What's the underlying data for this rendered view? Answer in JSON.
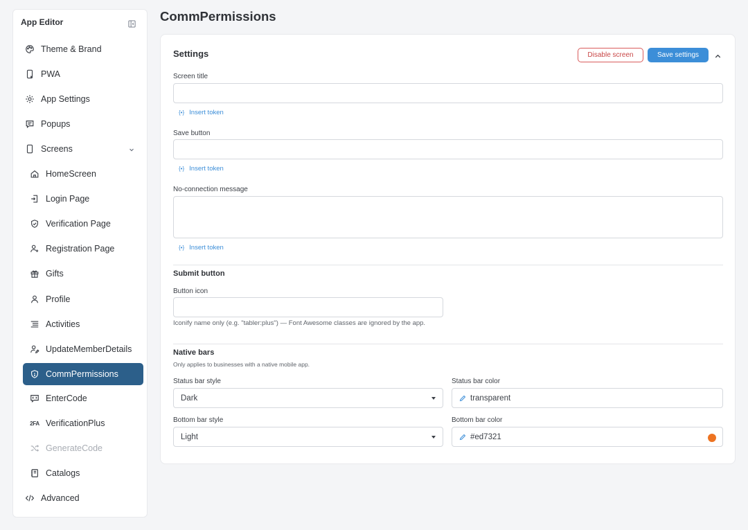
{
  "sidebar": {
    "title": "App Editor",
    "items": [
      {
        "label": "Theme & Brand",
        "icon": "palette-icon"
      },
      {
        "label": "PWA",
        "icon": "phone-icon"
      },
      {
        "label": "App Settings",
        "icon": "gear-icon"
      },
      {
        "label": "Popups",
        "icon": "message-icon"
      },
      {
        "label": "Screens",
        "icon": "phone-icon"
      },
      {
        "label": "HomeScreen",
        "icon": "home-icon"
      },
      {
        "label": "Login Page",
        "icon": "login-icon"
      },
      {
        "label": "Verification Page",
        "icon": "shield-check-icon"
      },
      {
        "label": "Registration Page",
        "icon": "user-plus-icon"
      },
      {
        "label": "Gifts",
        "icon": "gift-icon"
      },
      {
        "label": "Profile",
        "icon": "user-icon"
      },
      {
        "label": "Activities",
        "icon": "list-icon"
      },
      {
        "label": "UpdateMemberDetails",
        "icon": "user-edit-icon"
      },
      {
        "label": "CommPermissions",
        "icon": "shield-icon"
      },
      {
        "label": "EnterCode",
        "icon": "code-chat-icon"
      },
      {
        "label": "VerificationPlus",
        "icon": "2fa-icon",
        "icon_text": "2FA"
      },
      {
        "label": "GenerateCode",
        "icon": "shuffle-icon"
      },
      {
        "label": "Catalogs",
        "icon": "book-icon"
      },
      {
        "label": "Advanced",
        "icon": "code-icon"
      }
    ]
  },
  "page": {
    "title": "CommPermissions"
  },
  "settings": {
    "title": "Settings",
    "disable_label": "Disable screen",
    "save_label": "Save settings",
    "screen_title_label": "Screen title",
    "screen_title_value": "",
    "save_button_label": "Save button",
    "save_button_value": "",
    "no_connection_label": "No-connection message",
    "no_connection_value": "",
    "insert_token": "Insert token",
    "token_icon_text": "{•}",
    "submit_section": "Submit button",
    "button_icon_label": "Button icon",
    "button_icon_value": "",
    "button_icon_help": "Iconify name only (e.g. \"tabler:plus\") — Font Awesome classes are ignored by the app.",
    "native_section": "Native bars",
    "native_help": "Only applies to businesses with a native mobile app.",
    "status_style_label": "Status bar style",
    "status_style_value": "Dark",
    "status_color_label": "Status bar color",
    "status_color_value": "transparent",
    "bottom_style_label": "Bottom bar style",
    "bottom_style_value": "Light",
    "bottom_color_label": "Bottom bar color",
    "bottom_color_value": "#ed7321",
    "bottom_color_swatch": "#ed7321"
  },
  "colors": {
    "accent": "#3c8ed8",
    "active_nav": "#2c5f8a",
    "danger": "#d95a5a"
  }
}
